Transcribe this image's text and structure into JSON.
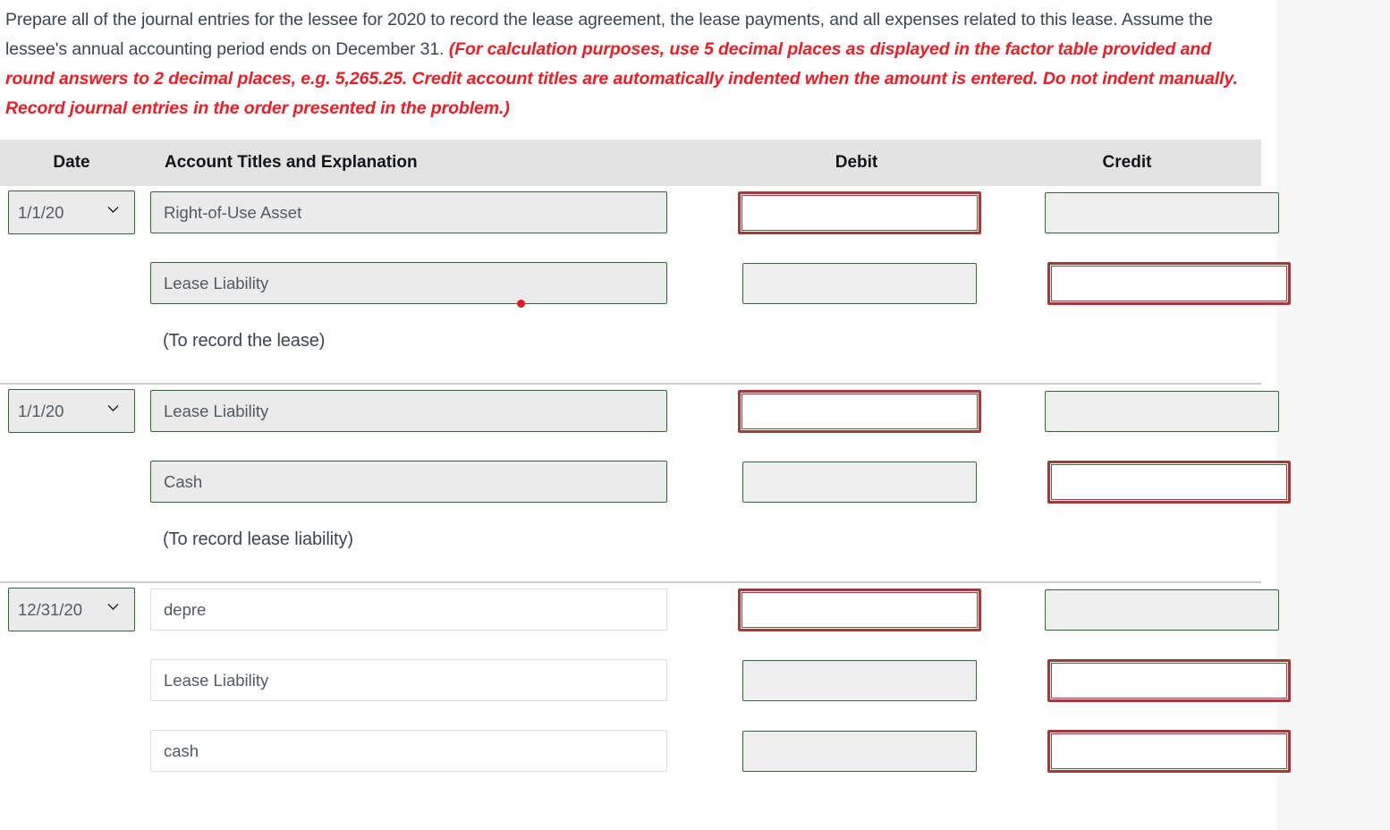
{
  "instructions": {
    "part1": "Prepare all of the journal entries for the lessee for 2020 to record the lease agreement, the lease payments, and all expenses related to this lease. Assume the lessee's annual accounting period ends on December 31. ",
    "part2_highlighted": "(For calculation purposes, use 5 decimal places as displayed in the factor table provided and round answers to 2 decimal places, e.g. 5,265.25. Credit account titles are automatically indented when the amount is entered. Do not indent manually. Record journal entries in the order presented in the problem.)"
  },
  "table": {
    "headers": {
      "date": "Date",
      "account": "Account Titles and Explanation",
      "debit": "Debit",
      "credit": "Credit"
    },
    "entries": [
      {
        "date_value": "1/1/20",
        "lines": [
          {
            "account": "Right-of-Use Asset",
            "debit_state": "active",
            "credit_state": "disabled"
          },
          {
            "account": "Lease Liability",
            "debit_state": "disabled",
            "credit_state": "active"
          }
        ],
        "memo": "(To record the lease)"
      },
      {
        "date_value": "1/1/20",
        "lines": [
          {
            "account": "Lease Liability",
            "debit_state": "active",
            "credit_state": "disabled"
          },
          {
            "account": "Cash",
            "debit_state": "disabled",
            "credit_state": "active"
          }
        ],
        "memo": "(To record lease liability)"
      },
      {
        "date_value": "12/31/20",
        "lines": [
          {
            "account": "depre",
            "debit_state": "active",
            "credit_state": "disabled"
          },
          {
            "account": "Lease Liability",
            "debit_state": "disabled",
            "credit_state": "active"
          },
          {
            "account": "cash",
            "debit_state": "disabled",
            "credit_state": "active"
          }
        ],
        "memo": ""
      }
    ]
  },
  "colors": {
    "highlight_red": "#ee1c25",
    "active_box_border": "#a33a37",
    "disabled_box_border": "#2c6b32",
    "header_bg": "#e3e3e3",
    "text": "#3b4552",
    "marker_dot": "#e01b24"
  }
}
